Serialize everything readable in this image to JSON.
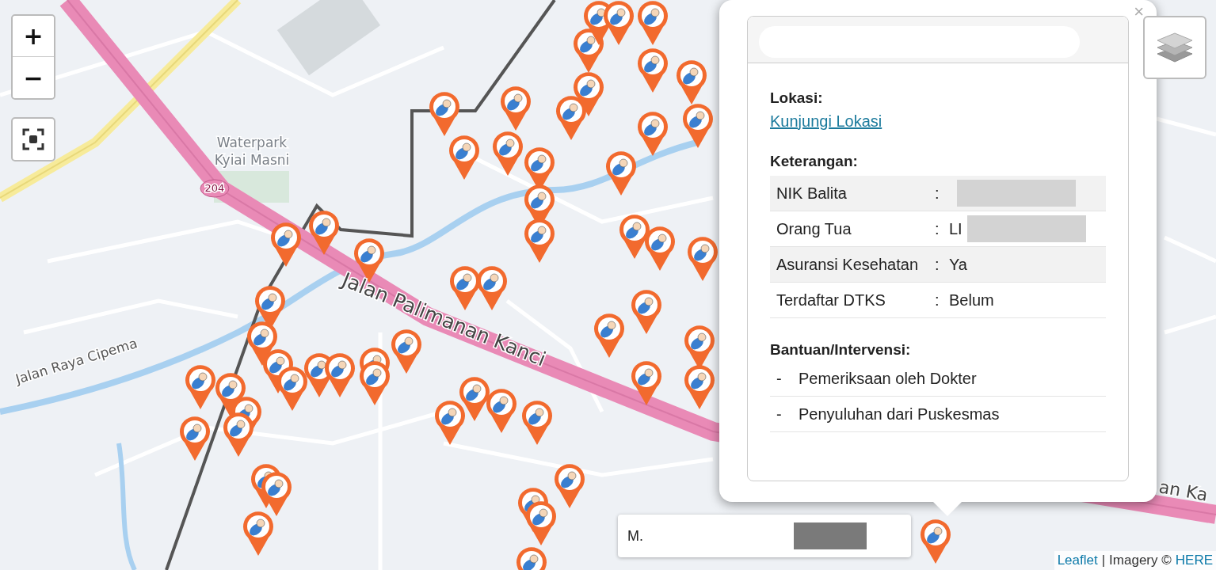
{
  "map": {
    "labels": [
      {
        "text": "Waterpark"
      },
      {
        "text": "Kyiai Masni"
      },
      {
        "text": "204"
      },
      {
        "text": "Jalan Raya Cipema"
      },
      {
        "text": "Jalan Palimanan Kanci"
      },
      {
        "text": "an Ka"
      }
    ]
  },
  "zoom_controls": [
    {
      "label": "+"
    },
    {
      "label": "−"
    }
  ],
  "popup": {
    "title_redacted": true,
    "close": "×",
    "location_heading": "Lokasi:",
    "location_link": "Kunjungi Lokasi",
    "details_heading": "Keterangan:",
    "details": [
      {
        "label": "NIK Balita",
        "separator": ":",
        "redacted": true
      },
      {
        "label": "Orang Tua",
        "separator": ":",
        "value": "LI",
        "redacted": true
      },
      {
        "label": "Asuransi Kesehatan",
        "separator": ":",
        "value": "Ya",
        "redacted": false
      },
      {
        "label": "Terdaftar DTKS",
        "separator": ":",
        "value": "Belum",
        "redacted": false
      }
    ],
    "aid_heading": "Bantuan/Intervensi:",
    "aid": [
      {
        "bullet": "-",
        "text": "Pemeriksaan oleh Dokter"
      },
      {
        "bullet": "-",
        "text": "Penyuluhan dari Puskesmas"
      }
    ]
  },
  "tooltip": {
    "text": "M.",
    "redacted": true
  },
  "attribution": [
    {
      "text": "Leaflet",
      "kind": "link"
    },
    {
      "text": "|",
      "kind": "text"
    },
    {
      "text": "Imagery ©",
      "kind": "text"
    },
    {
      "text": "HERE",
      "kind": "link"
    }
  ]
}
